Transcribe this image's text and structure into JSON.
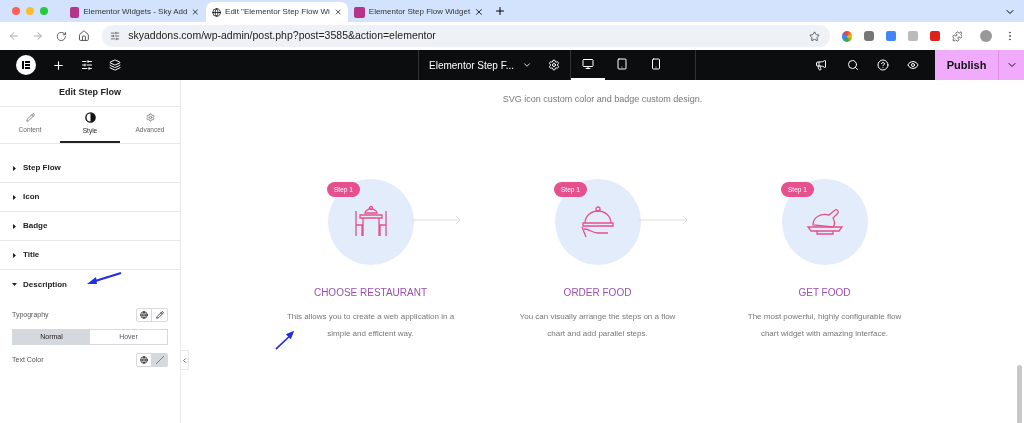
{
  "browser": {
    "tabs": [
      {
        "title": "Elementor Widgets - Sky Add",
        "selected": false
      },
      {
        "title": "Edit \"Elementor Step Flow Wi",
        "selected": true
      },
      {
        "title": "Elementor Step Flow Widget",
        "selected": false
      }
    ],
    "url": "skyaddons.com/wp-admin/post.php?post=3585&action=elementor"
  },
  "editor_bar": {
    "document_title": "Elementor Step F...",
    "devices": [
      {
        "kind": "desktop",
        "selected": true
      },
      {
        "kind": "tablet",
        "selected": false
      },
      {
        "kind": "mobile",
        "selected": false
      }
    ],
    "publish": "Publish"
  },
  "panel": {
    "title": "Edit Step Flow",
    "tabs": [
      {
        "kind": "content",
        "label": "Content",
        "selected": false
      },
      {
        "kind": "style",
        "label": "Style",
        "selected": true
      },
      {
        "kind": "advanced",
        "label": "Advanced",
        "selected": false
      }
    ],
    "sections": [
      {
        "label": "Step Flow",
        "expanded": false
      },
      {
        "label": "Icon",
        "expanded": false
      },
      {
        "label": "Badge",
        "expanded": false
      },
      {
        "label": "Title",
        "expanded": false
      },
      {
        "label": "Description",
        "expanded": true
      }
    ],
    "typography_label": "Typography",
    "state_tabs": [
      {
        "label": "Normal",
        "selected": true
      },
      {
        "label": "Hover",
        "selected": false
      }
    ],
    "text_color_label": "Text Color"
  },
  "canvas": {
    "subtitle": "SVG icon custom color and badge custom design.",
    "steps": [
      {
        "badge": "Step 1",
        "kind": "dining",
        "title": "CHOOSE RESTAURANT",
        "description": "This allows you to create a web application in a simple and efficient way."
      },
      {
        "badge": "Step 1",
        "kind": "cloche",
        "title": "ORDER FOOD",
        "description": "You can visually arrange the steps on a flow chart and add parallel steps."
      },
      {
        "badge": "Step 1",
        "kind": "chicken",
        "title": "GET FOOD",
        "description": "The most powerful, highly configurable flow chart widget with amazing interface."
      }
    ]
  }
}
